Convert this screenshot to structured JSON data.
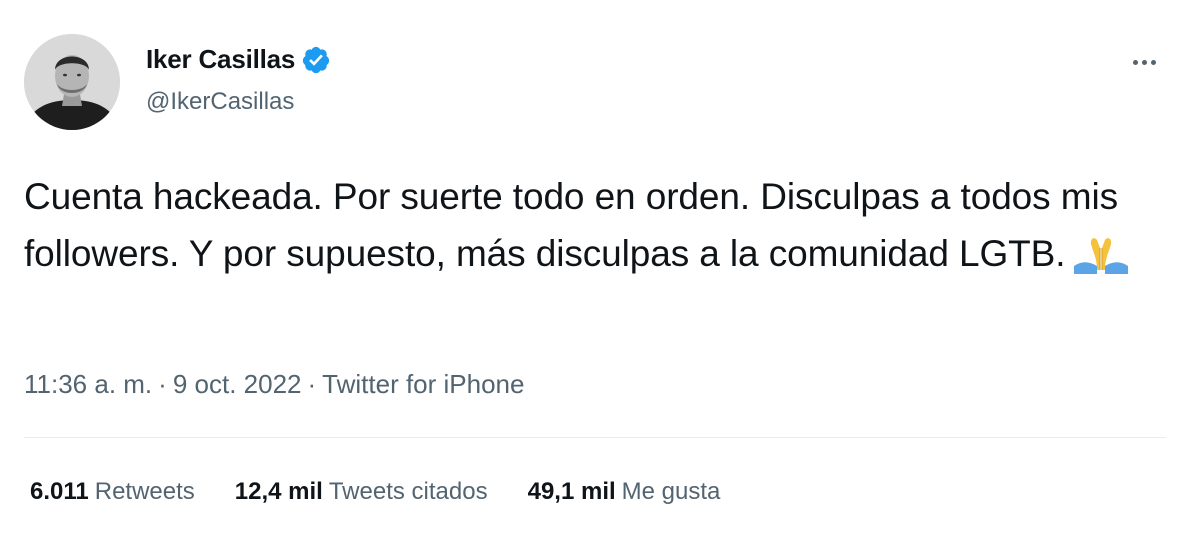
{
  "tweet": {
    "author": {
      "name": "Iker Casillas",
      "handle": "@IkerCasillas",
      "verified": true
    },
    "text": "Cuenta hackeada. Por suerte todo en orden. Disculpas a todos mis followers. Y por supuesto, más disculpas a la comunidad LGTB.",
    "emoji": "folded-hands",
    "time": "11:36 a. m.",
    "separator": "·",
    "date": "9 oct. 2022",
    "source": "Twitter for iPhone",
    "stats": {
      "retweets_count": "6.011",
      "retweets_label": "Retweets",
      "quotes_count": "12,4 mil",
      "quotes_label": "Tweets citados",
      "likes_count": "49,1 mil",
      "likes_label": "Me gusta"
    }
  },
  "colors": {
    "text_primary": "#0f1419",
    "text_secondary": "#536471",
    "verified_blue": "#1d9bf0",
    "divider": "#e6ecf0"
  },
  "icons": {
    "more": "more-horizontal-icon",
    "verified": "verified-badge-icon"
  }
}
